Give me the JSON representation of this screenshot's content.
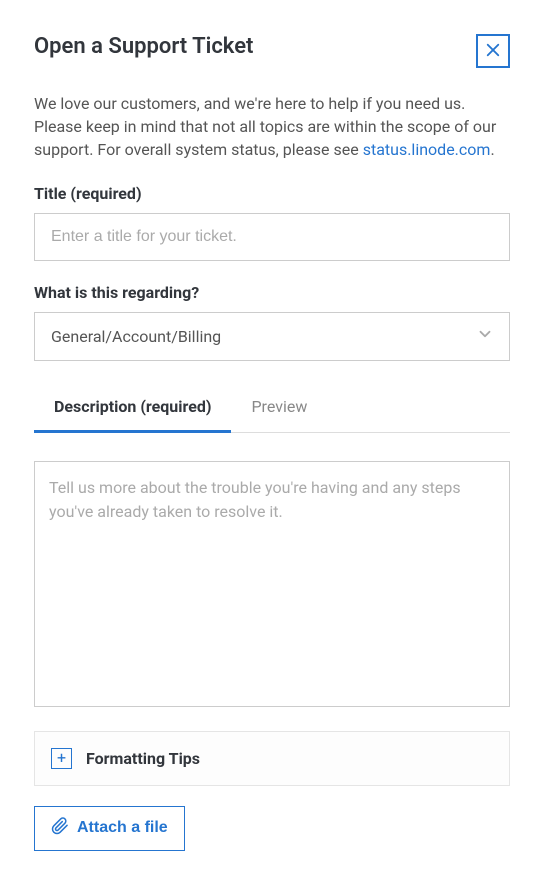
{
  "header": {
    "title": "Open a Support Ticket"
  },
  "intro": {
    "text_before": "We love our customers, and we're here to help if you need us. Please keep in mind that not all topics are within the scope of our support. For overall system status, please see ",
    "link_text": "status.linode.com",
    "text_after": "."
  },
  "title_field": {
    "label": "Title (required)",
    "placeholder": "Enter a title for your ticket.",
    "value": ""
  },
  "regarding": {
    "label": "What is this regarding?",
    "selected": "General/Account/Billing"
  },
  "tabs": {
    "description": "Description (required)",
    "preview": "Preview"
  },
  "description": {
    "placeholder": "Tell us more about the trouble you're having and any steps you've already taken to resolve it.",
    "value": ""
  },
  "formatting": {
    "label": "Formatting Tips"
  },
  "attach": {
    "label": "Attach a file"
  }
}
